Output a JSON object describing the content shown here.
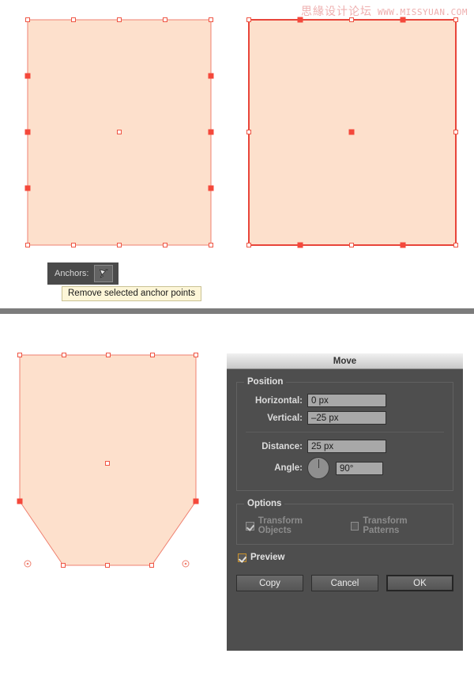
{
  "watermark": {
    "cn_text": "思緣设计论坛",
    "url_text": "WWW.MISSYUAN.COM",
    "color": "#eeaeae"
  },
  "artwork": {
    "fill_color": "#fde0cc",
    "stroke_color": "#e8705e",
    "selected_anchor_color": "#f4483b",
    "shapes": [
      {
        "name": "rectangle-all-anchors",
        "description": "Rectangle with 16 anchor points, 6 side anchors selected"
      },
      {
        "name": "rectangle-path-selected",
        "description": "Rectangle with full path selected, alternating anchors on top and bottom"
      },
      {
        "name": "pentagon-result",
        "description": "Shape after moving bottom anchors up 25 px, bottom corners chamfered"
      }
    ]
  },
  "anchors_widget": {
    "label": "Anchors:",
    "icon": "pen-remove-anchor-icon",
    "tooltip": "Remove selected anchor points",
    "tooltip_bg": "#fdf6d8"
  },
  "dialog": {
    "title": "Move",
    "position_group": {
      "legend": "Position",
      "fields": [
        {
          "label": "Horizontal:",
          "value": "0 px"
        },
        {
          "label": "Vertical:",
          "value": "–25 px"
        },
        {
          "label": "Distance:",
          "value": "25 px"
        },
        {
          "label": "Angle:",
          "value": "90°"
        }
      ]
    },
    "options_group": {
      "legend": "Options",
      "transform_objects": {
        "label": "Transform Objects",
        "checked": true,
        "enabled": false
      },
      "transform_patterns": {
        "label": "Transform Patterns",
        "checked": false,
        "enabled": false
      }
    },
    "preview": {
      "label": "Preview",
      "checked": true,
      "accent": "#c8902c"
    },
    "buttons": {
      "copy": "Copy",
      "cancel": "Cancel",
      "ok": "OK"
    }
  }
}
